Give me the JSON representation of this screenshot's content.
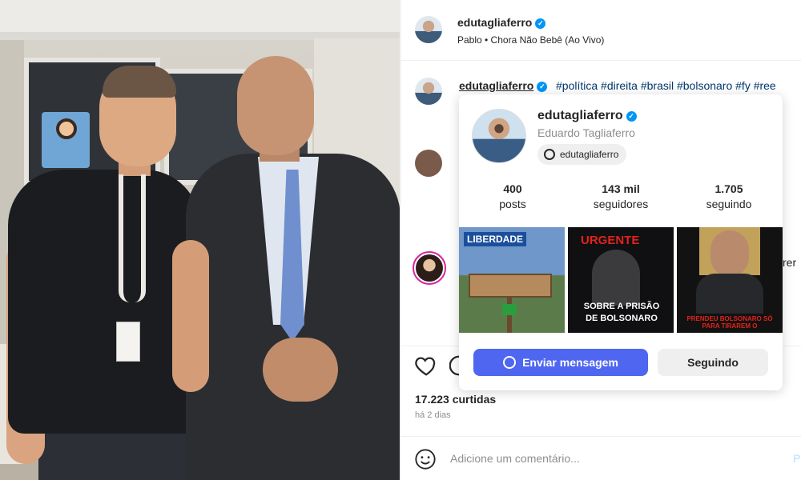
{
  "post_header": {
    "username": "edutagliaferro",
    "music": "Pablo • Chora Não Bebê (Ao Vivo)"
  },
  "caption": {
    "username": "edutagliaferro",
    "hashtags": "#política #direita #brasil #bolsonaro #fy #ree"
  },
  "hover_card": {
    "username": "edutagliaferro",
    "full_name": "Eduardo Tagliaferro",
    "threads_handle": "edutagliaferro",
    "stats": [
      {
        "value": "400",
        "label": "posts"
      },
      {
        "value": "143 mil",
        "label": "seguidores"
      },
      {
        "value": "1.705",
        "label": "seguindo"
      }
    ],
    "thumbnails": [
      {
        "title": "LIBERDADE",
        "subtitle": ""
      },
      {
        "title": "URGENTE",
        "subtitle": "SOBRE A PRISÃO DE BOLSONARO"
      },
      {
        "title": "",
        "subtitle": "PRENDEU BOLSONARO SÓ PARA TIRAREM O"
      }
    ],
    "message_button": "Enviar mensagem",
    "following_button": "Seguindo"
  },
  "side_text": "rer",
  "actions": {
    "likes": "17.223 curtidas",
    "time": "há 2 dias"
  },
  "comment_box": {
    "placeholder": "Adicione um comentário...",
    "post_label": "P"
  },
  "colors": {
    "verified": "#0095f6",
    "hashtag": "#00376b",
    "message_button": "#4f66f0"
  }
}
